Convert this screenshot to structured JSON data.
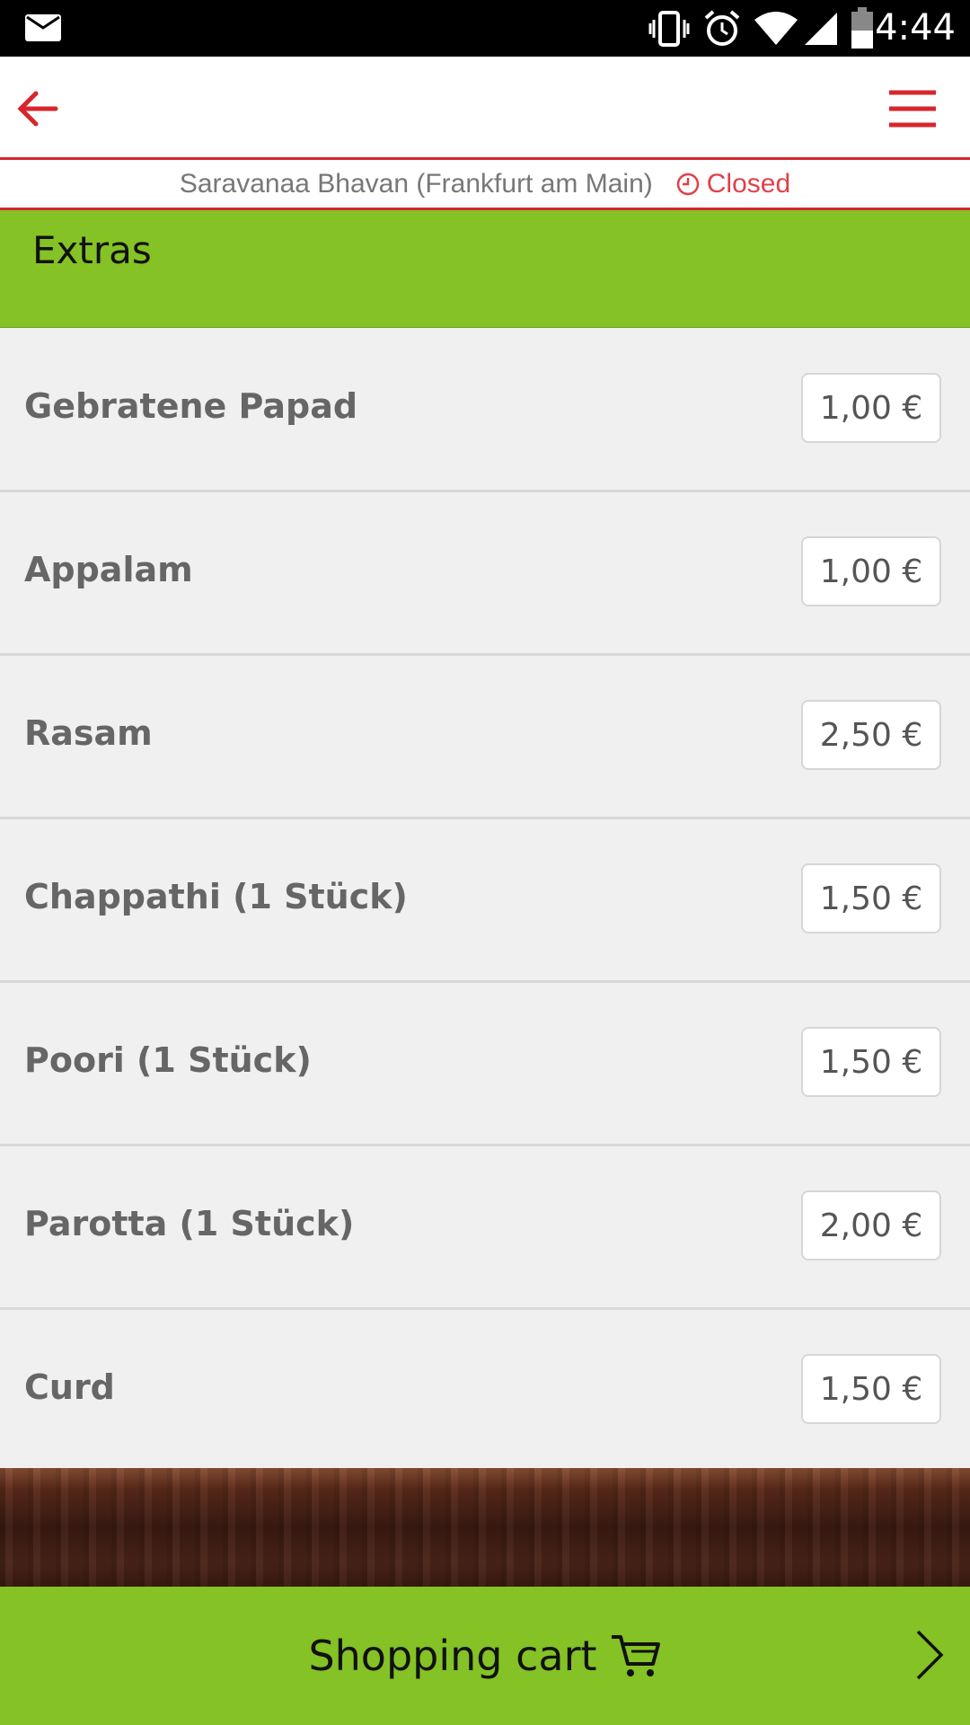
{
  "status_bar": {
    "time": "4:44"
  },
  "restaurant": {
    "name": "Saravanaa Bhavan (Frankfurt am Main)",
    "status": "Closed"
  },
  "category": {
    "title": "Extras"
  },
  "items": [
    {
      "name": "Gebratene Papad",
      "price": "1,00 €"
    },
    {
      "name": "Appalam",
      "price": "1,00 €"
    },
    {
      "name": "Rasam",
      "price": "2,50 €"
    },
    {
      "name": "Chappathi (1 Stück)",
      "price": "1,50 €"
    },
    {
      "name": "Poori (1 Stück)",
      "price": "1,50 €"
    },
    {
      "name": "Parotta (1 Stück)",
      "price": "2,00 €"
    },
    {
      "name": "Curd",
      "price": "1,50 €"
    }
  ],
  "cart": {
    "label": "Shopping cart"
  },
  "colors": {
    "accent_red": "#d7262b",
    "accent_green": "#84c225"
  },
  "icons": [
    "mail-icon",
    "vibrate-icon",
    "alarm-icon",
    "wifi-icon",
    "signal-icon",
    "battery-icon",
    "back-arrow-icon",
    "hamburger-menu-icon",
    "clock-icon",
    "cart-icon",
    "chevron-right-icon"
  ]
}
